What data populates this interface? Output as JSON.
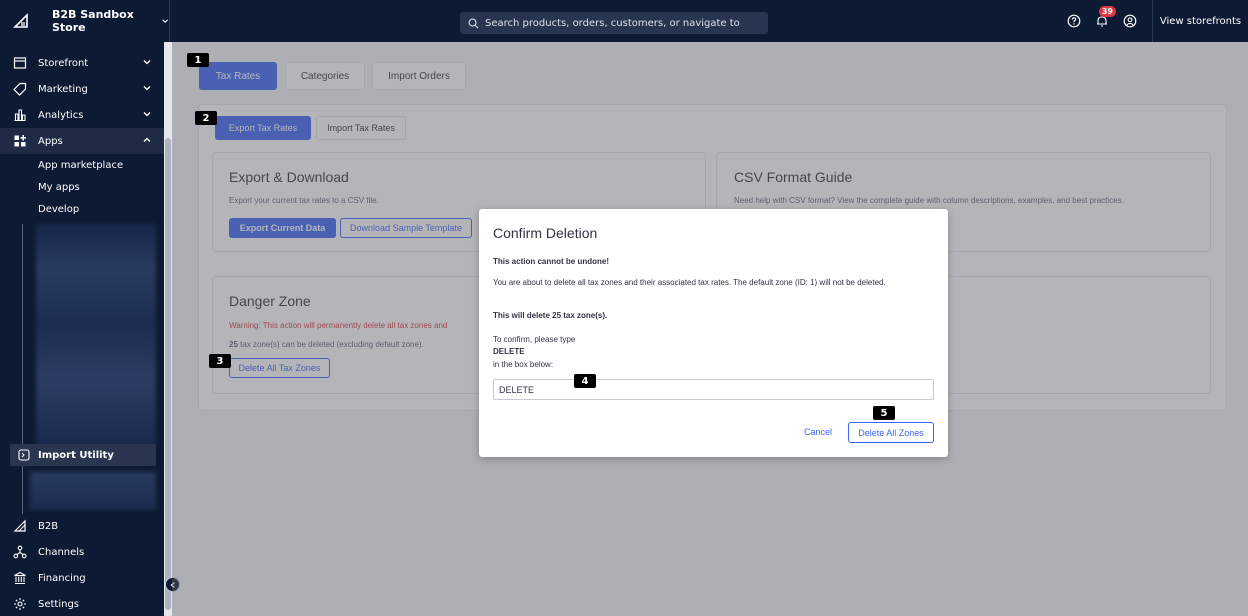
{
  "topbar": {
    "store_name": "B2B Sandbox Store",
    "search_placeholder": "Search products, orders, customers, or navigate to",
    "notification_count": "39",
    "view_storefronts": "View storefronts"
  },
  "sidebar": {
    "items": [
      {
        "label": "Storefront",
        "icon": "storefront-icon"
      },
      {
        "label": "Marketing",
        "icon": "tag-icon"
      },
      {
        "label": "Analytics",
        "icon": "analytics-icon"
      },
      {
        "label": "Apps",
        "icon": "apps-icon"
      }
    ],
    "apps_sub": [
      "App marketplace",
      "My apps",
      "Develop"
    ],
    "import_utility": "Import Utility",
    "bottom": [
      {
        "label": "B2B",
        "icon": "b2b-icon"
      },
      {
        "label": "Channels",
        "icon": "channels-icon"
      },
      {
        "label": "Financing",
        "icon": "bank-icon"
      },
      {
        "label": "Settings",
        "icon": "settings-icon"
      }
    ]
  },
  "main": {
    "tabs": [
      "Tax Rates",
      "Categories",
      "Import Orders"
    ],
    "subtabs": [
      "Export Tax Rates",
      "Import Tax Rates"
    ],
    "export_card": {
      "title": "Export & Download",
      "desc": "Export your current tax rates to a CSV file.",
      "export_btn": "Export Current Data",
      "sample_btn": "Download Sample Template"
    },
    "csv_card": {
      "title": "CSV Format Guide",
      "desc": "Need help with CSV format? View the complete guide with column descriptions, examples, and best practices."
    },
    "danger_card": {
      "title": "Danger Zone",
      "warning": "Warning: This action will permanently delete all tax zones and",
      "count": "25",
      "count_text": "tax zone(s) can be deleted (excluding default zone).",
      "delete_btn": "Delete All Tax Zones"
    }
  },
  "modal": {
    "title": "Confirm Deletion",
    "warning": "This action cannot be undone!",
    "body": "You are about to delete all tax zones and their associated tax rates. The default zone (ID: 1) will not be deleted.",
    "count_line": "This will delete 25 tax zone(s).",
    "confirm_1": "To confirm, please type",
    "confirm_word": "DELETE",
    "confirm_2": "in the box below:",
    "input_value": "DELETE",
    "cancel": "Cancel",
    "delete_all": "Delete All Zones"
  },
  "annotations": [
    "1",
    "2",
    "3",
    "4",
    "5"
  ],
  "colors": {
    "sidebar_bg": "#0d1a33",
    "primary": "#3c64f4",
    "danger": "#db3643"
  }
}
